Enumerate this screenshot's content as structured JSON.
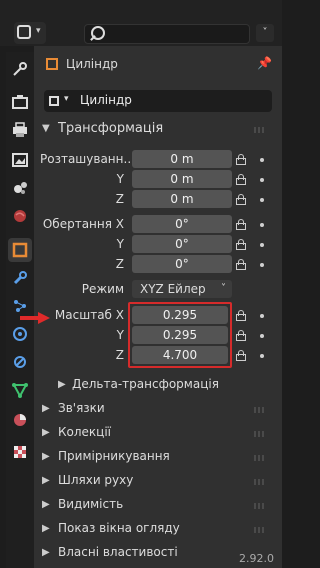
{
  "toolbar": {
    "search_placeholder": "",
    "options_chevron": "˅"
  },
  "properties": {
    "header": {
      "object_name": "Циліндр"
    },
    "object_field": {
      "name": "Циліндр"
    },
    "sections": {
      "transform": "Трансформація",
      "delta_transform": "Дельта-трансформація",
      "relations": "Зв'язки",
      "collections": "Колекції",
      "instancing": "Примірникування",
      "motion_paths": "Шляхи руху",
      "visibility": "Видимість",
      "viewport_display": "Показ вікна огляду",
      "custom_props": "Власні властивості"
    },
    "transform": {
      "location_label": "Розташуванн...",
      "rotation_label": "Обертання X",
      "mode_label": "Режим",
      "mode_value": "XYZ Ейлер",
      "scale_label": "Масштаб X",
      "y_label": "Y",
      "z_label": "Z",
      "location": [
        "0 m",
        "0 m",
        "0 m"
      ],
      "rotation": [
        "0°",
        "0°",
        "0°"
      ],
      "scale": [
        "0.295",
        "0.295",
        "4.700"
      ]
    }
  },
  "status": {
    "version": "2.92.0"
  },
  "colors": {
    "highlight_box": "#d62b2b",
    "object_icon": "#e88b36"
  }
}
